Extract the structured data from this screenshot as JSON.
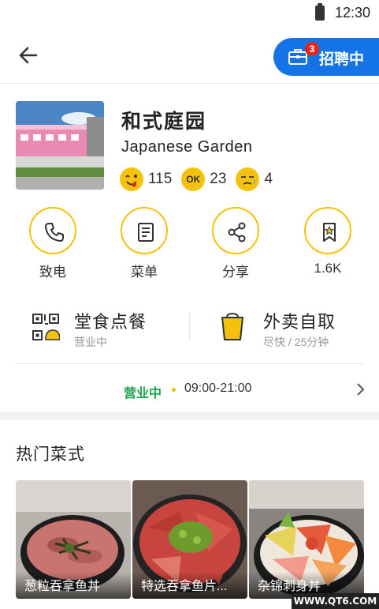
{
  "status_bar": {
    "time": "12:30",
    "battery_icon": "battery-icon"
  },
  "header": {
    "back_icon": "arrow-left-icon",
    "hire_badge": "3",
    "hire_label": "招聘中",
    "hire_color": "#1473e6"
  },
  "restaurant": {
    "name_cn": "和式庭园",
    "name_en": "Japanese Garden",
    "ratings": [
      {
        "icon": "yummy-face-icon",
        "count": "115"
      },
      {
        "icon": "ok-face-icon",
        "label": "OK",
        "count": "23"
      },
      {
        "icon": "sad-face-icon",
        "count": "4"
      }
    ]
  },
  "actions": [
    {
      "icon": "phone-icon",
      "label": "致电"
    },
    {
      "icon": "menu-book-icon",
      "label": "菜单"
    },
    {
      "icon": "share-icon",
      "label": "分享"
    },
    {
      "icon": "bookmark-star-icon",
      "label": "1.6K"
    }
  ],
  "order_options": [
    {
      "icon": "qr-order-icon",
      "title": "堂食点餐",
      "subtitle": "营业中"
    },
    {
      "icon": "takeaway-cup-icon",
      "title": "外卖自取",
      "subtitle": "尽快 / 25分钟"
    }
  ],
  "hours": {
    "status": "营业中",
    "time": "09:00-21:00"
  },
  "popular": {
    "title": "热门菜式",
    "dishes": [
      {
        "label": "葱粒吞拿鱼丼"
      },
      {
        "label": "特选吞拿鱼片..."
      },
      {
        "label": "杂锦刺身丼"
      }
    ]
  },
  "watermark": "WWW.QT6.COM",
  "colors": {
    "accent": "#f4c20d",
    "open_green": "#1aa34a",
    "badge_red": "#e5271d"
  }
}
